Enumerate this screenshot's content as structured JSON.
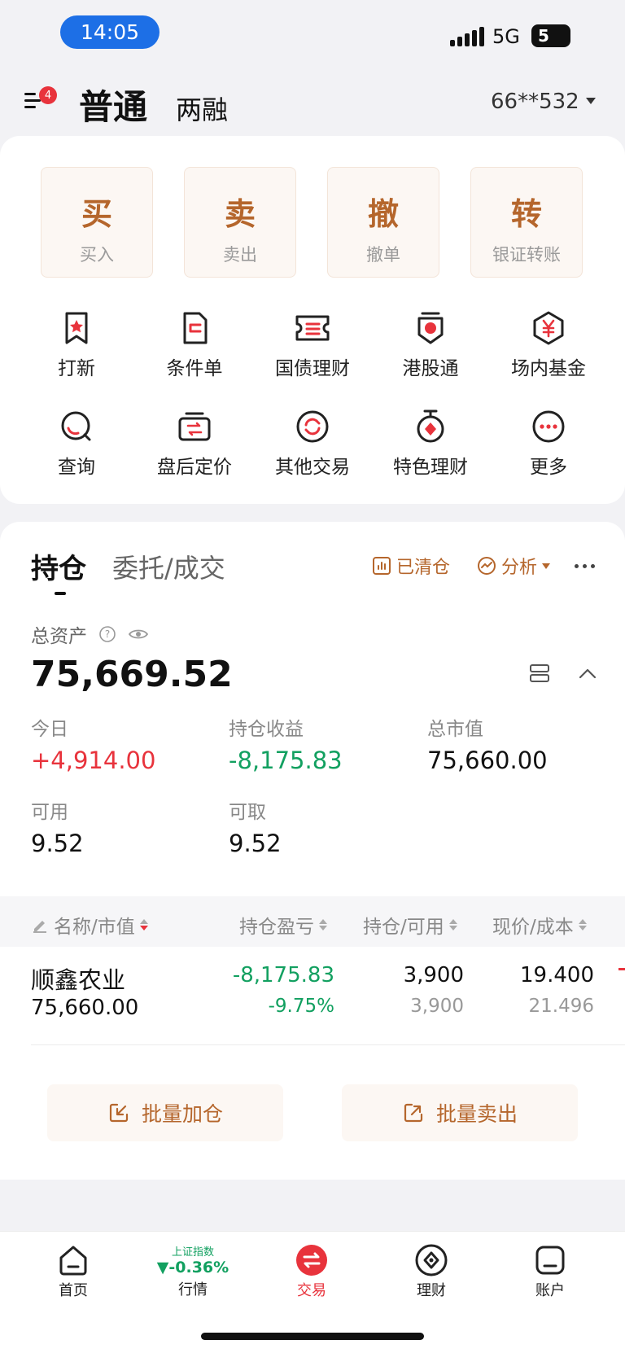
{
  "status": {
    "time": "14:05",
    "network": "5G",
    "battery": "5"
  },
  "header": {
    "title": "普通",
    "subtitle": "两融",
    "badge": "4",
    "account": "66**532"
  },
  "actions": [
    {
      "big": "买",
      "small": "买入"
    },
    {
      "big": "卖",
      "small": "卖出"
    },
    {
      "big": "撤",
      "small": "撤单"
    },
    {
      "big": "转",
      "small": "银证转账"
    }
  ],
  "grid": [
    {
      "label": "打新",
      "icon": "ribbon-icon"
    },
    {
      "label": "条件单",
      "icon": "document-icon"
    },
    {
      "label": "国债理财",
      "icon": "ticket-icon"
    },
    {
      "label": "港股通",
      "icon": "hk-flag-icon"
    },
    {
      "label": "场内基金",
      "icon": "yen-hexagon-icon"
    },
    {
      "label": "查询",
      "icon": "search-icon"
    },
    {
      "label": "盘后定价",
      "icon": "exchange-box-icon"
    },
    {
      "label": "其他交易",
      "icon": "refresh-icon"
    },
    {
      "label": "特色理财",
      "icon": "medal-icon"
    },
    {
      "label": "更多",
      "icon": "more-icon"
    }
  ],
  "holdings": {
    "tabs": [
      "持仓",
      "委托/成交"
    ],
    "cleared": "已清仓",
    "analysis": "分析",
    "total_asset_label": "总资产",
    "total_asset": "75,669.52",
    "stats": [
      {
        "label": "今日",
        "value": "+4,914.00",
        "color": "#e8333c"
      },
      {
        "label": "持仓收益",
        "value": "-8,175.83",
        "color": "#12a060"
      },
      {
        "label": "总市值",
        "value": "75,660.00",
        "color": "#111111"
      },
      {
        "label": "可用",
        "value": "9.52",
        "color": "#111111"
      },
      {
        "label": "可取",
        "value": "9.52",
        "color": "#111111"
      }
    ],
    "columns": [
      "名称/市值",
      "持仓盈亏",
      "持仓/可用",
      "现价/成本"
    ],
    "rows": [
      {
        "name": "顺鑫农业",
        "market_value": "75,660.00",
        "pnl": "-8,175.83",
        "pnl_pct": "-9.75%",
        "position": "3,900",
        "available": "3,900",
        "price": "19.400",
        "cost": "21.496"
      }
    ],
    "batch_add": "批量加仓",
    "batch_sell": "批量卖出"
  },
  "nav": {
    "home": "首页",
    "market": "行情",
    "index_name": "上证指数",
    "index_change": "▼-0.36%",
    "trade": "交易",
    "finance": "理财",
    "account": "账户"
  },
  "colors": {
    "accent": "#b5662c",
    "up": "#e8333c",
    "down": "#12a060"
  }
}
